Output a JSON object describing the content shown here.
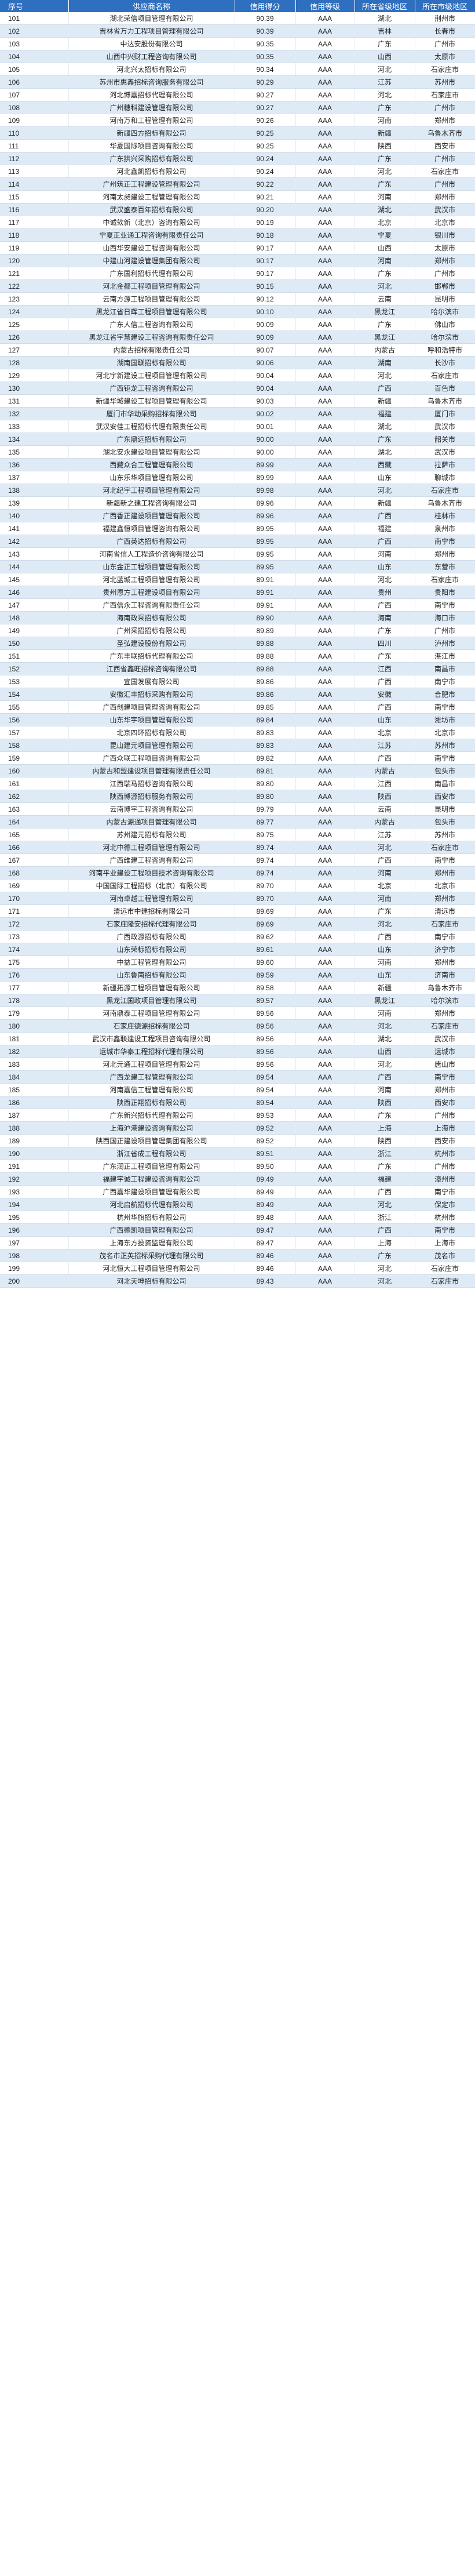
{
  "table": {
    "headers": [
      "序号",
      "供应商名称",
      "信用得分",
      "信用等级",
      "所在省级地区",
      "所在市级地区"
    ],
    "rows": [
      [
        "101",
        "湖北荣信项目管理有限公司",
        "90.39",
        "AAA",
        "湖北",
        "荆州市"
      ],
      [
        "102",
        "吉林省万力工程项目管理有限公司",
        "90.39",
        "AAA",
        "吉林",
        "长春市"
      ],
      [
        "103",
        "中达安股份有限公司",
        "90.35",
        "AAA",
        "广东",
        "广州市"
      ],
      [
        "104",
        "山西中兴财工程咨询有限公司",
        "90.35",
        "AAA",
        "山西",
        "太原市"
      ],
      [
        "105",
        "河北兴太招标有限公司",
        "90.34",
        "AAA",
        "河北",
        "石家庄市"
      ],
      [
        "106",
        "苏州市惠鑫招标咨询服务有限公司",
        "90.29",
        "AAA",
        "江苏",
        "苏州市"
      ],
      [
        "107",
        "河北博嘉招标代理有限公司",
        "90.27",
        "AAA",
        "河北",
        "石家庄市"
      ],
      [
        "108",
        "广州穗科建设管理有限公司",
        "90.27",
        "AAA",
        "广东",
        "广州市"
      ],
      [
        "109",
        "河南万和工程管理有限公司",
        "90.26",
        "AAA",
        "河南",
        "郑州市"
      ],
      [
        "110",
        "新疆四方招标有限公司",
        "90.25",
        "AAA",
        "新疆",
        "乌鲁木齐市"
      ],
      [
        "111",
        "华夏国际项目咨询有限公司",
        "90.25",
        "AAA",
        "陕西",
        "西安市"
      ],
      [
        "112",
        "广东拱兴采购招标有限公司",
        "90.24",
        "AAA",
        "广东",
        "广州市"
      ],
      [
        "113",
        "河北鑫凯招标有限公司",
        "90.24",
        "AAA",
        "河北",
        "石家庄市"
      ],
      [
        "114",
        "广州筑正工程建设管理有限公司",
        "90.22",
        "AAA",
        "广东",
        "广州市"
      ],
      [
        "115",
        "河南太昶建设工程管理有限公司",
        "90.21",
        "AAA",
        "河南",
        "郑州市"
      ],
      [
        "116",
        "武汉盛泰百年招标有限公司",
        "90.20",
        "AAA",
        "湖北",
        "武汉市"
      ],
      [
        "117",
        "中诚软新（北京）咨询有限公司",
        "90.19",
        "AAA",
        "北京",
        "北京市"
      ],
      [
        "118",
        "宁夏正业通工程咨询有限责任公司",
        "90.18",
        "AAA",
        "宁夏",
        "银川市"
      ],
      [
        "119",
        "山西华安建设工程咨询有限公司",
        "90.17",
        "AAA",
        "山西",
        "太原市"
      ],
      [
        "120",
        "中建山河建设管理集团有限公司",
        "90.17",
        "AAA",
        "河南",
        "郑州市"
      ],
      [
        "121",
        "广东国利招标代理有限公司",
        "90.17",
        "AAA",
        "广东",
        "广州市"
      ],
      [
        "122",
        "河北金都工程项目管理有限公司",
        "90.15",
        "AAA",
        "河北",
        "邯郸市"
      ],
      [
        "123",
        "云南方源工程项目管理有限公司",
        "90.12",
        "AAA",
        "云南",
        "昆明市"
      ],
      [
        "124",
        "黑龙江省日晖工程项目管理有限公司",
        "90.10",
        "AAA",
        "黑龙江",
        "哈尔滨市"
      ],
      [
        "125",
        "广东人信工程咨询有限公司",
        "90.09",
        "AAA",
        "广东",
        "佛山市"
      ],
      [
        "126",
        "黑龙江省宇慧建设工程咨询有限责任公司",
        "90.09",
        "AAA",
        "黑龙江",
        "哈尔滨市"
      ],
      [
        "127",
        "内蒙古招标有限责任公司",
        "90.07",
        "AAA",
        "内蒙古",
        "呼和浩特市"
      ],
      [
        "128",
        "湖南国联招标有限公司",
        "90.06",
        "AAA",
        "湖南",
        "长沙市"
      ],
      [
        "129",
        "河北宇新建设工程项目管理有限公司",
        "90.04",
        "AAA",
        "河北",
        "石家庄市"
      ],
      [
        "130",
        "广西钜龙工程咨询有限公司",
        "90.04",
        "AAA",
        "广西",
        "百色市"
      ],
      [
        "131",
        "新疆华城建设工程项目管理有限公司",
        "90.03",
        "AAA",
        "新疆",
        "乌鲁木齐市"
      ],
      [
        "132",
        "厦门市华动采购招标有限公司",
        "90.02",
        "AAA",
        "福建",
        "厦门市"
      ],
      [
        "133",
        "武汉安佳工程招标代理有限责任公司",
        "90.01",
        "AAA",
        "湖北",
        "武汉市"
      ],
      [
        "134",
        "广东鼎远招标有限公司",
        "90.00",
        "AAA",
        "广东",
        "韶关市"
      ],
      [
        "135",
        "湖北安永建设项目管理有限公司",
        "90.00",
        "AAA",
        "湖北",
        "武汉市"
      ],
      [
        "136",
        "西藏众合工程管理有限公司",
        "89.99",
        "AAA",
        "西藏",
        "拉萨市"
      ],
      [
        "137",
        "山东乐华项目管理有限公司",
        "89.99",
        "AAA",
        "山东",
        "聊城市"
      ],
      [
        "138",
        "河北纪宇工程项目管理有限公司",
        "89.98",
        "AAA",
        "河北",
        "石家庄市"
      ],
      [
        "139",
        "新疆新之建工程咨询有限公司",
        "89.96",
        "AAA",
        "新疆",
        "乌鲁木齐市"
      ],
      [
        "140",
        "广西香正建设项目管理有限公司",
        "89.96",
        "AAA",
        "广西",
        "桂林市"
      ],
      [
        "141",
        "福建鑫恒项目管理咨询有限公司",
        "89.95",
        "AAA",
        "福建",
        "泉州市"
      ],
      [
        "142",
        "广西英达招标有限公司",
        "89.95",
        "AAA",
        "广西",
        "南宁市"
      ],
      [
        "143",
        "河南省信人工程造价咨询有限公司",
        "89.95",
        "AAA",
        "河南",
        "郑州市"
      ],
      [
        "144",
        "山东金正工程项目管理有限公司",
        "89.95",
        "AAA",
        "山东",
        "东营市"
      ],
      [
        "145",
        "河北蓝城工程项目管理有限公司",
        "89.91",
        "AAA",
        "河北",
        "石家庄市"
      ],
      [
        "146",
        "贵州恩方工程建设项目有限公司",
        "89.91",
        "AAA",
        "贵州",
        "贵阳市"
      ],
      [
        "147",
        "广西信永工程咨询有限责任公司",
        "89.91",
        "AAA",
        "广西",
        "南宁市"
      ],
      [
        "148",
        "海南政采招标有限公司",
        "89.90",
        "AAA",
        "海南",
        "海口市"
      ],
      [
        "149",
        "广州采招招标有限公司",
        "89.89",
        "AAA",
        "广东",
        "广州市"
      ],
      [
        "150",
        "圣弘建设股份有限公司",
        "89.88",
        "AAA",
        "四川",
        "泸州市"
      ],
      [
        "151",
        "广东丰联招标代理有限公司",
        "89.88",
        "AAA",
        "广东",
        "湛江市"
      ],
      [
        "152",
        "江西省鑫旺招标咨询有限公司",
        "89.88",
        "AAA",
        "江西",
        "南昌市"
      ],
      [
        "153",
        "宜国发展有限公司",
        "89.86",
        "AAA",
        "广西",
        "南宁市"
      ],
      [
        "154",
        "安徽汇丰招标采购有限公司",
        "89.86",
        "AAA",
        "安徽",
        "合肥市"
      ],
      [
        "155",
        "广西创建项目管理咨询有限公司",
        "89.85",
        "AAA",
        "广西",
        "南宁市"
      ],
      [
        "156",
        "山东华宇项目管理有限公司",
        "89.84",
        "AAA",
        "山东",
        "潍坊市"
      ],
      [
        "157",
        "北京四环招标有限公司",
        "89.83",
        "AAA",
        "北京",
        "北京市"
      ],
      [
        "158",
        "昆山建元项目管理有限公司",
        "89.83",
        "AAA",
        "江苏",
        "苏州市"
      ],
      [
        "159",
        "广西众联工程项目咨询有限公司",
        "89.82",
        "AAA",
        "广西",
        "南宁市"
      ],
      [
        "160",
        "内蒙古和盟建设项目管理有限责任公司",
        "89.81",
        "AAA",
        "内蒙古",
        "包头市"
      ],
      [
        "161",
        "江西瑞马招标咨询有限公司",
        "89.80",
        "AAA",
        "江西",
        "南昌市"
      ],
      [
        "162",
        "陕西博源招标服务有限公司",
        "89.80",
        "AAA",
        "陕西",
        "西安市"
      ],
      [
        "163",
        "云南博宇工程咨询有限公司",
        "89.79",
        "AAA",
        "云南",
        "昆明市"
      ],
      [
        "164",
        "内蒙古源通项目管理有限公司",
        "89.77",
        "AAA",
        "内蒙古",
        "包头市"
      ],
      [
        "165",
        "苏州建元招标有限公司",
        "89.75",
        "AAA",
        "江苏",
        "苏州市"
      ],
      [
        "166",
        "河北中德工程项目管理有限公司",
        "89.74",
        "AAA",
        "河北",
        "石家庄市"
      ],
      [
        "167",
        "广西维建工程咨询有限公司",
        "89.74",
        "AAA",
        "广西",
        "南宁市"
      ],
      [
        "168",
        "河南平业建设工程项目技术咨询有限公司",
        "89.74",
        "AAA",
        "河南",
        "郑州市"
      ],
      [
        "169",
        "中国国际工程招标（北京）有限公司",
        "89.70",
        "AAA",
        "北京",
        "北京市"
      ],
      [
        "170",
        "河南卓越工程管理有限公司",
        "89.70",
        "AAA",
        "河南",
        "郑州市"
      ],
      [
        "171",
        "清远市中建招标有限公司",
        "89.69",
        "AAA",
        "广东",
        "清远市"
      ],
      [
        "172",
        "石家庄隆安招标代理有限公司",
        "89.69",
        "AAA",
        "河北",
        "石家庄市"
      ],
      [
        "173",
        "广西政源招标有限公司",
        "89.62",
        "AAA",
        "广西",
        "南宁市"
      ],
      [
        "174",
        "山东荣标招标有限公司",
        "89.61",
        "AAA",
        "山东",
        "济宁市"
      ],
      [
        "175",
        "中益工程管理有限公司",
        "89.60",
        "AAA",
        "河南",
        "郑州市"
      ],
      [
        "176",
        "山东鲁南招标有限公司",
        "89.59",
        "AAA",
        "山东",
        "济南市"
      ],
      [
        "177",
        "新疆拓源工程项目管理有限公司",
        "89.58",
        "AAA",
        "新疆",
        "乌鲁木齐市"
      ],
      [
        "178",
        "黑龙江国政项目管理有限公司",
        "89.57",
        "AAA",
        "黑龙江",
        "哈尔滨市"
      ],
      [
        "179",
        "河南鼎泰工程项目管理有限公司",
        "89.56",
        "AAA",
        "河南",
        "郑州市"
      ],
      [
        "180",
        "石家庄德源招标有限公司",
        "89.56",
        "AAA",
        "河北",
        "石家庄市"
      ],
      [
        "181",
        "武汉市鑫联建设工程项目咨询有限公司",
        "89.56",
        "AAA",
        "湖北",
        "武汉市"
      ],
      [
        "182",
        "运城市华泰工程招标代理有限公司",
        "89.56",
        "AAA",
        "山西",
        "运城市"
      ],
      [
        "183",
        "河北元通工程项目管理有限公司",
        "89.56",
        "AAA",
        "河北",
        "唐山市"
      ],
      [
        "184",
        "广西龙建工程管理有限公司",
        "89.54",
        "AAA",
        "广西",
        "南宁市"
      ],
      [
        "185",
        "河南嘉信工程管理有限公司",
        "89.54",
        "AAA",
        "河南",
        "郑州市"
      ],
      [
        "186",
        "陕西正翔招标有限公司",
        "89.54",
        "AAA",
        "陕西",
        "西安市"
      ],
      [
        "187",
        "广东新兴招标代理有限公司",
        "89.53",
        "AAA",
        "广东",
        "广州市"
      ],
      [
        "188",
        "上海沪港建设咨询有限公司",
        "89.52",
        "AAA",
        "上海",
        "上海市"
      ],
      [
        "189",
        "陕西国正建设项目管理集团有限公司",
        "89.52",
        "AAA",
        "陕西",
        "西安市"
      ],
      [
        "190",
        "浙江省成工程有限公司",
        "89.51",
        "AAA",
        "浙江",
        "杭州市"
      ],
      [
        "191",
        "广东润正工程项目管理有限公司",
        "89.50",
        "AAA",
        "广东",
        "广州市"
      ],
      [
        "192",
        "福建宇诚工程建设咨询有限公司",
        "89.49",
        "AAA",
        "福建",
        "漳州市"
      ],
      [
        "193",
        "广西嘉华建设项目管理有限公司",
        "89.49",
        "AAA",
        "广西",
        "南宁市"
      ],
      [
        "194",
        "河北启航招标代理有限公司",
        "89.49",
        "AAA",
        "河北",
        "保定市"
      ],
      [
        "195",
        "杭州华旗招标有限公司",
        "89.48",
        "AAA",
        "浙江",
        "杭州市"
      ],
      [
        "196",
        "广西德凯项目管理有限公司",
        "89.47",
        "AAA",
        "广西",
        "南宁市"
      ],
      [
        "197",
        "上海东方投资监理有限公司",
        "89.47",
        "AAA",
        "上海",
        "上海市"
      ],
      [
        "198",
        "茂名市正英招标采购代理有限公司",
        "89.46",
        "AAA",
        "广东",
        "茂名市"
      ],
      [
        "199",
        "河北恒大工程项目管理有限公司",
        "89.46",
        "AAA",
        "河北",
        "石家庄市"
      ],
      [
        "200",
        "河北天坤招标有限公司",
        "89.43",
        "AAA",
        "河北",
        "石家庄市"
      ]
    ]
  }
}
